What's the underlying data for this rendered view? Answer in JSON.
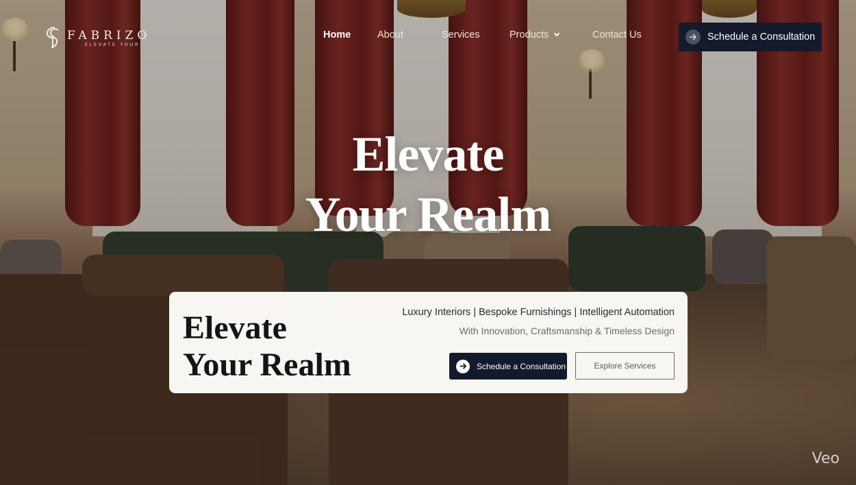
{
  "brand": {
    "name": "FABRIZO",
    "tagline": "ELEVATE YOUR"
  },
  "nav": {
    "items": [
      {
        "label": "Home",
        "active": true
      },
      {
        "label": "About",
        "active": false
      },
      {
        "label": "Services",
        "active": false
      },
      {
        "label": "Products",
        "active": false,
        "has_dropdown": true,
        "dropdown_icon": "chevron-down-icon"
      },
      {
        "label": "Contact Us",
        "active": false
      }
    ],
    "cta_label": "Schedule a Consultation",
    "cta_icon": "arrow-right-icon"
  },
  "hero": {
    "line1": "Elevate",
    "line2": "Your Realm"
  },
  "card": {
    "title_line1": "Elevate",
    "title_line2": "Your Realm",
    "tagline": "Luxury Interiors | Bespoke Furnishings | Intelligent Automation",
    "subtitle": "With Innovation, Craftsmanship & Timeless Design",
    "primary_button": "Schedule a Consultation",
    "secondary_button": "Explore Services"
  },
  "watermark": "Veo",
  "colors": {
    "navy": "#121a2c",
    "card_bg": "#f7f6f3",
    "text_light": "#ffffff"
  }
}
